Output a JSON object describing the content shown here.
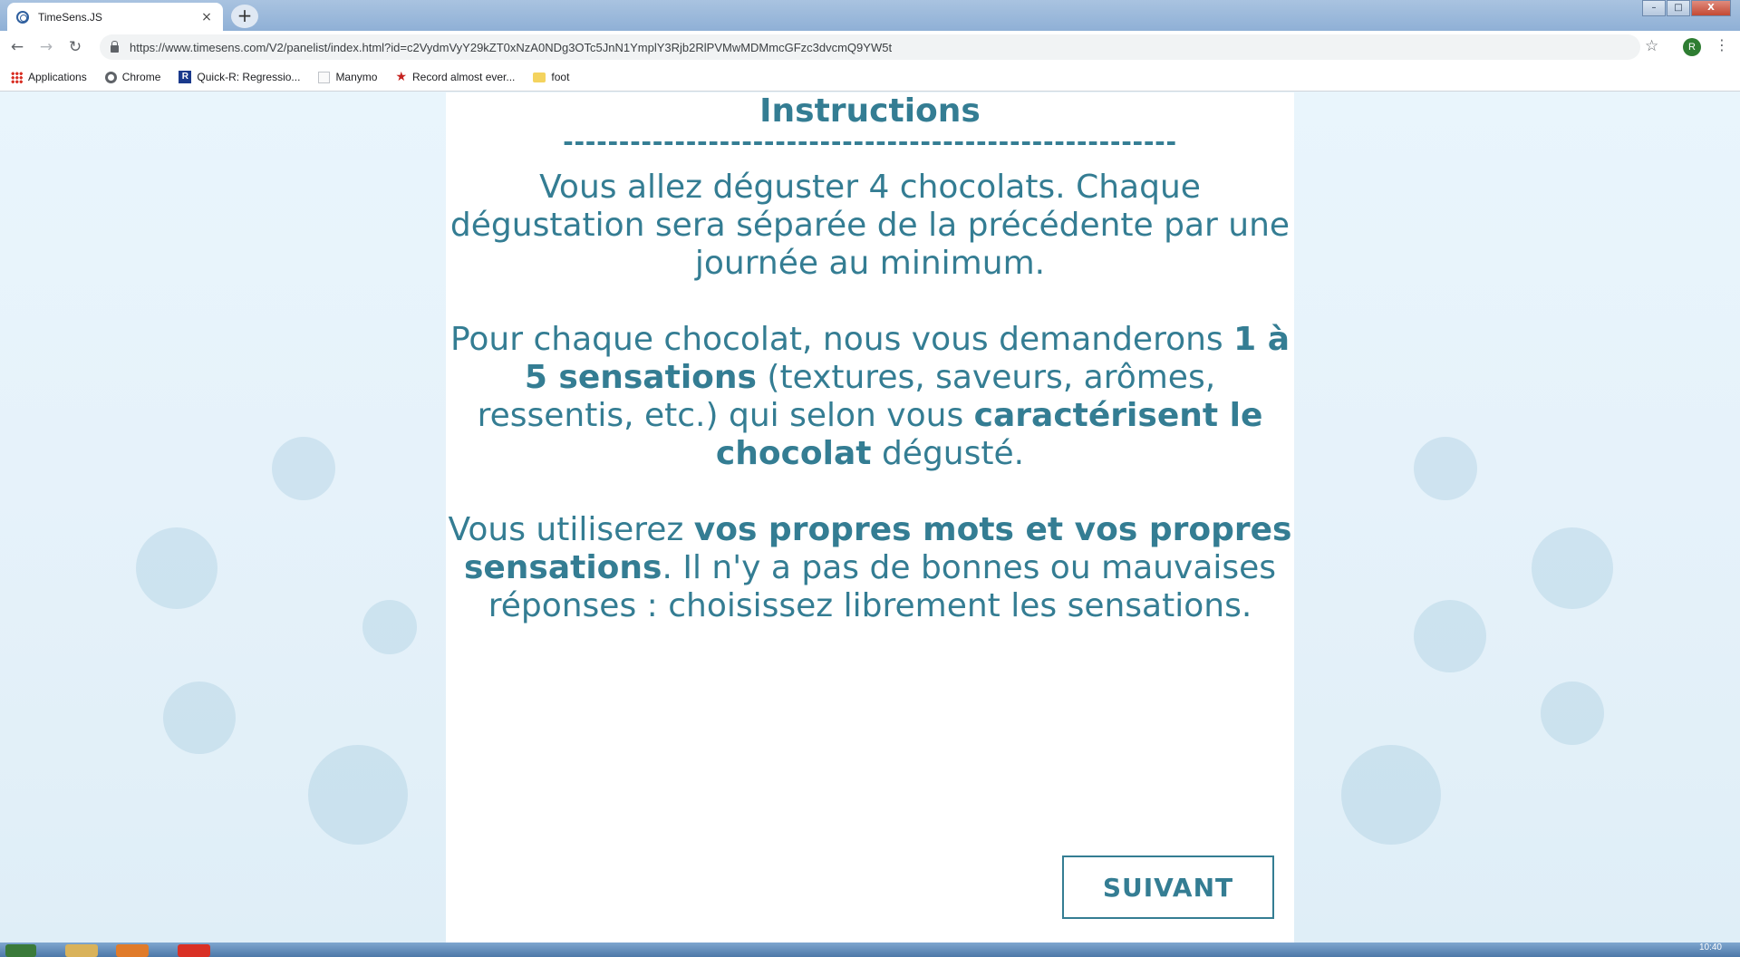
{
  "browser": {
    "tab_title": "TimeSens.JS",
    "tab_close": "×",
    "new_tab": "+",
    "url": "https://www.timesens.com/V2/panelist/index.html?id=c2VydmVyY29kZT0xNzA0NDg3OTc5JnN1YmplY3Rjb2RlPVMwMDMmcGFzc3dvcmQ9YW5t",
    "nav": {
      "back": "←",
      "forward": "→",
      "reload": "↻"
    },
    "star": "☆",
    "profile_initial": "R",
    "menu": "⋮",
    "window_controls": {
      "minimize": "–",
      "maximize": "□",
      "close": "X"
    }
  },
  "bookmarks": [
    {
      "label": "Applications",
      "icon": "apps-grid-icon"
    },
    {
      "label": "Chrome",
      "icon": "chrome-icon"
    },
    {
      "label": "Quick-R: Regressio...",
      "icon": "r-logo-icon"
    },
    {
      "label": "Manymo",
      "icon": "blank-page-icon"
    },
    {
      "label": "Record almost ever...",
      "icon": "star-bookmark-icon"
    },
    {
      "label": "foot",
      "icon": "folder-icon"
    }
  ],
  "content": {
    "title": "Instructions",
    "separator": "-------------------------------------------------------",
    "p1": "Vous allez déguster 4 chocolats. Chaque dégustation sera séparée de la précédente par une journée au minimum.",
    "p2": {
      "a": "Pour chaque chocolat, nous vous demanderons ",
      "b": "1 à 5 sensations",
      "c": " (textures, saveurs, arômes, ressentis, etc.) qui selon vous ",
      "d": "caractérisent le chocolat",
      "e": " dégusté."
    },
    "p3": {
      "a": "Vous utiliserez ",
      "b": "vos propres mots et vos propres sensations",
      "c": ". Il n'y a pas de bonnes ou mauvaises réponses : choisissez librement les sensations."
    },
    "next_button": "SUIVANT"
  },
  "colors": {
    "accent": "#347d93",
    "page_background": "#e8f4fb",
    "card_background": "#ffffff"
  },
  "taskbar": {
    "clock": "10:40"
  }
}
